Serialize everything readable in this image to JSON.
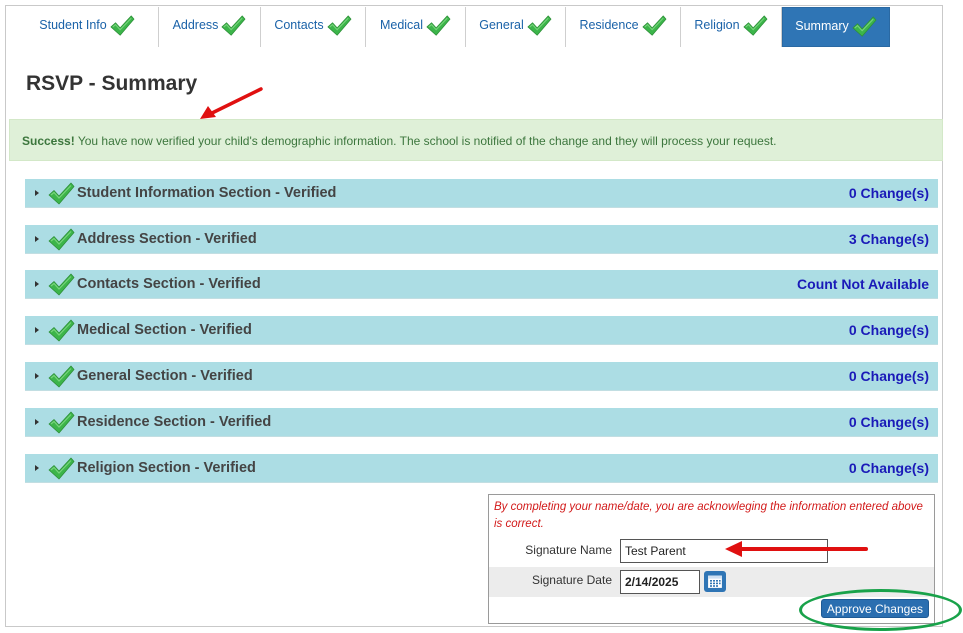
{
  "tabs": [
    {
      "label": "Student Info",
      "active": false
    },
    {
      "label": "Address",
      "active": false
    },
    {
      "label": "Contacts",
      "active": false
    },
    {
      "label": "Medical",
      "active": false
    },
    {
      "label": "General",
      "active": false
    },
    {
      "label": "Residence",
      "active": false
    },
    {
      "label": "Religion",
      "active": false
    },
    {
      "label": "Summary",
      "active": true
    }
  ],
  "page": {
    "title": "RSVP - Summary"
  },
  "alert": {
    "strong": "Success!",
    "message": " You have now verified your child's demographic information. The school is notified of the change and they will process your request."
  },
  "sections": [
    {
      "title": "Student Information Section - Verified",
      "count": "0 Change(s)"
    },
    {
      "title": "Address Section - Verified",
      "count": "3 Change(s)"
    },
    {
      "title": "Contacts Section - Verified",
      "count": "Count Not Available"
    },
    {
      "title": "Medical Section - Verified",
      "count": "0 Change(s)"
    },
    {
      "title": "General Section - Verified",
      "count": "0 Change(s)"
    },
    {
      "title": "Residence Section - Verified",
      "count": "0 Change(s)"
    },
    {
      "title": "Religion Section - Verified",
      "count": "0 Change(s)"
    }
  ],
  "signature": {
    "notice": "By completing your name/date, you are acknowleging the information entered above is correct.",
    "name_label": "Signature Name",
    "name_value": "Test Parent",
    "date_label": "Signature Date",
    "date_value": "2/14/2025",
    "approve_label": "Approve Changes"
  },
  "icons": {
    "check": "check-icon",
    "caret": "caret-right-icon",
    "calendar": "calendar-icon"
  },
  "colors": {
    "check_green": "#3cb54a",
    "tab_active": "#2f75b5",
    "section_bg": "#acdde4",
    "count_blue": "#1a1ab8",
    "annotation_red": "#e01010",
    "annotation_green": "#19a24a"
  }
}
